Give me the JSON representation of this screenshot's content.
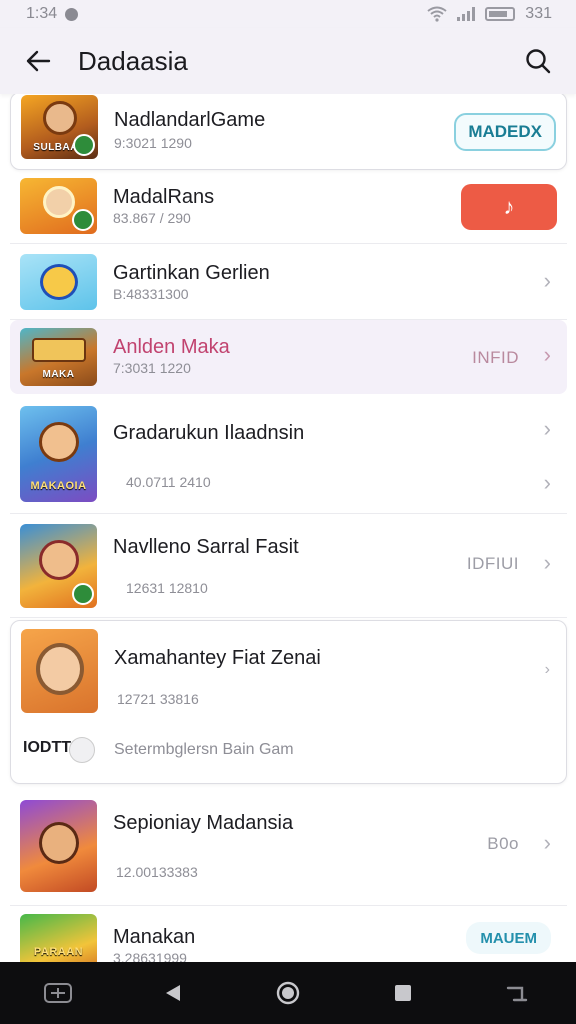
{
  "status_bar": {
    "time": "1:34",
    "battery": "331"
  },
  "app_bar": {
    "title": "Dadaasia"
  },
  "items": [
    {
      "title": "NadlandarlGame",
      "subtitle": "9:3021 1290",
      "action": "MADEDX",
      "thumb_text": "SULBAAN"
    },
    {
      "title": "MadalRans",
      "subtitle": "83.867 / 290",
      "action": "♪"
    },
    {
      "title": "Gartinkan Gerlien",
      "subtitle": "B:48331300"
    },
    {
      "title": "Anlden Maka",
      "subtitle": "7:3031 1220",
      "right_text": "INFID",
      "thumb_text": "MAKA"
    },
    {
      "title": "Gradarukun Ilaadnsin",
      "subtitle": "40.0711 2410",
      "thumb_text": "MAKAOIA"
    },
    {
      "title": "Navlleno Sarral Fasit",
      "subtitle": "12631 12810",
      "right_text": "IDFIUI"
    },
    {
      "title": "Xamahantey Fiat Zenai",
      "subtitle": "12721 33816",
      "footer_label": "IODTT",
      "footer_text": "Setermbglersn Bain Gam"
    },
    {
      "title": "Sepioniay Madansia",
      "subtitle": "12.00133383",
      "right_text": "B0o"
    },
    {
      "title": "Manakan",
      "subtitle": "3.28631999",
      "action": "MAUEM",
      "thumb_text": "PARAAN"
    }
  ],
  "colors": {
    "accent_red": "#ed5b45",
    "accent_teal": "#1a7d94",
    "highlight_title": "#c1436f"
  },
  "icons": [
    "back-arrow-icon",
    "search-icon",
    "chevron-right-icon",
    "music-note-icon",
    "nav-back-icon",
    "nav-home-icon",
    "nav-recents-icon"
  ]
}
